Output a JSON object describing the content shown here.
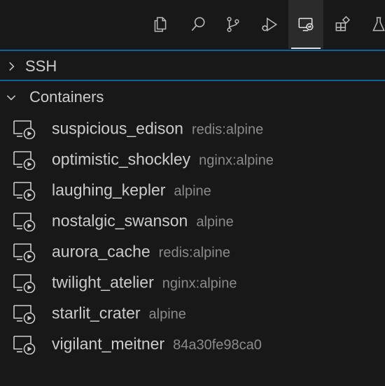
{
  "activity_bar": {
    "icons": [
      {
        "name": "explorer-icon"
      },
      {
        "name": "search-icon"
      },
      {
        "name": "source-control-icon"
      },
      {
        "name": "run-debug-icon"
      },
      {
        "name": "remote-explorer-icon",
        "active": true
      },
      {
        "name": "extensions-icon"
      },
      {
        "name": "testing-icon"
      }
    ]
  },
  "sections": {
    "ssh": {
      "title": "SSH",
      "expanded": false
    },
    "containers": {
      "title": "Containers",
      "expanded": true
    }
  },
  "containers": [
    {
      "name": "suspicious_edison",
      "image": "redis:alpine"
    },
    {
      "name": "optimistic_shockley",
      "image": "nginx:alpine"
    },
    {
      "name": "laughing_kepler",
      "image": "alpine"
    },
    {
      "name": "nostalgic_swanson",
      "image": "alpine"
    },
    {
      "name": "aurora_cache",
      "image": "redis:alpine"
    },
    {
      "name": "twilight_atelier",
      "image": "nginx:alpine"
    },
    {
      "name": "starlit_crater",
      "image": "alpine"
    },
    {
      "name": "vigilant_meitner",
      "image": "84a30fe98ca0"
    }
  ],
  "colors": {
    "background": "#181818",
    "focus_border": "#0e639c",
    "foreground": "#cccccc",
    "description": "#8b8b8b"
  }
}
